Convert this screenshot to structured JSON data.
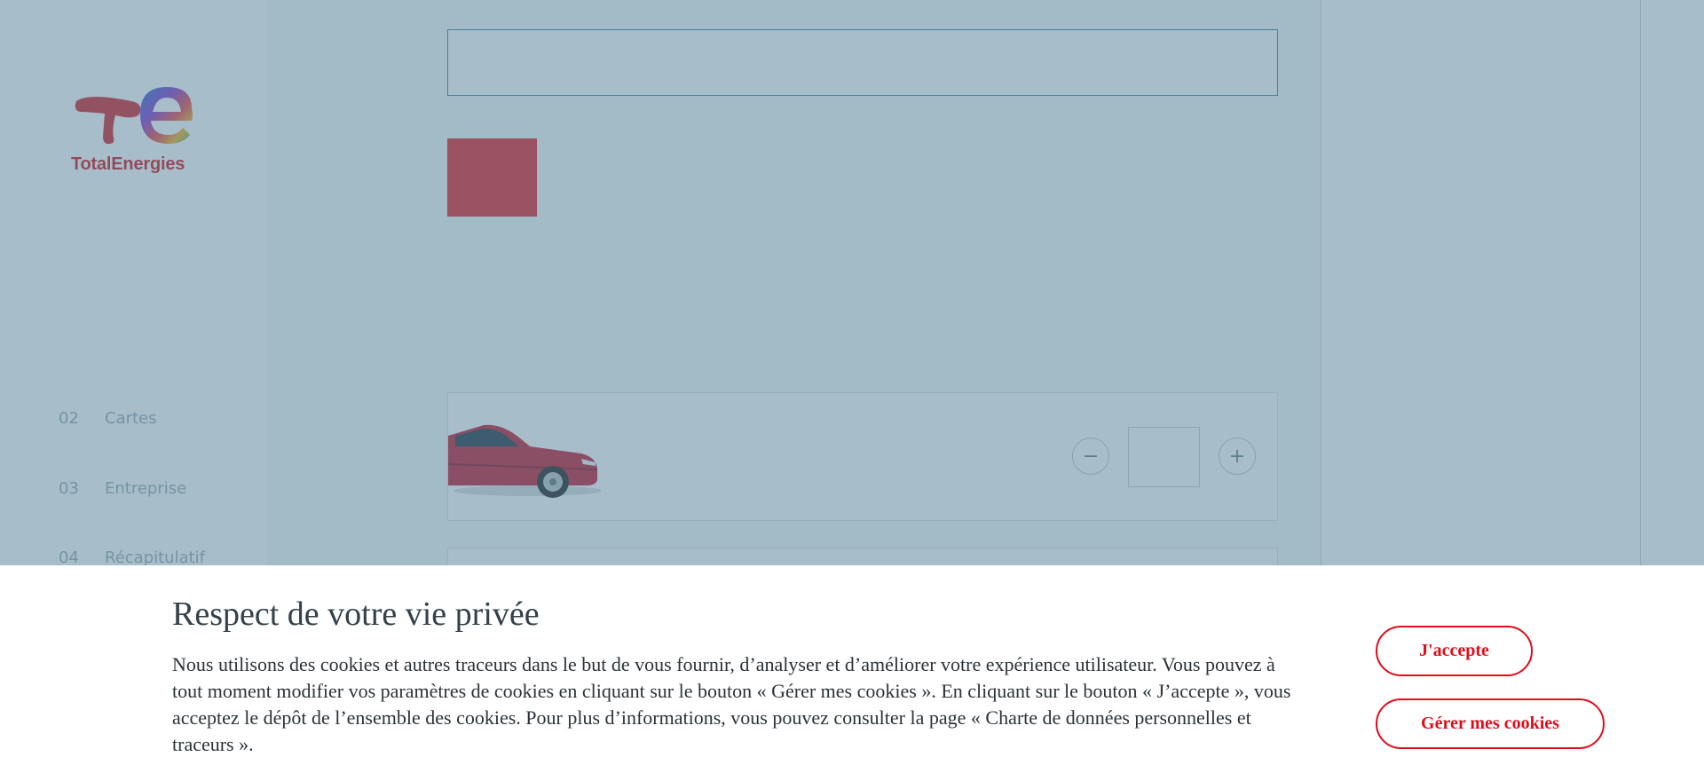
{
  "brand": {
    "name": "TotalEnergies"
  },
  "sidebar": {
    "steps": [
      {
        "number": "02",
        "label": "Cartes"
      },
      {
        "number": "03",
        "label": "Entreprise"
      },
      {
        "number": "04",
        "label": "Récapitulatif"
      }
    ]
  },
  "cookie_banner": {
    "title": "Respect de votre vie privée",
    "text": "Nous utilisons des cookies et autres traceurs dans le but de vous fournir, d’analyser et d’améliorer votre expérience utilisateur. Vous pouvez à tout moment modifier vos paramètres de cookies en cliquant sur le bouton « Gérer mes cookies ». En cliquant sur le bouton « J’accepte », vous acceptez le dépôt de l’ensemble des cookies. Pour plus d’informations, vous pouvez consulter la page « Charte de données personnelles et traceurs ».",
    "accept_label": "J'accepte",
    "manage_label": "Gérer mes cookies"
  },
  "stepper": {
    "minus_icon": "minus-icon",
    "plus_icon": "plus-icon"
  },
  "colors": {
    "brand_red": "#e00d1a",
    "overlay": "#507d96",
    "input_border": "#3a88b8"
  }
}
